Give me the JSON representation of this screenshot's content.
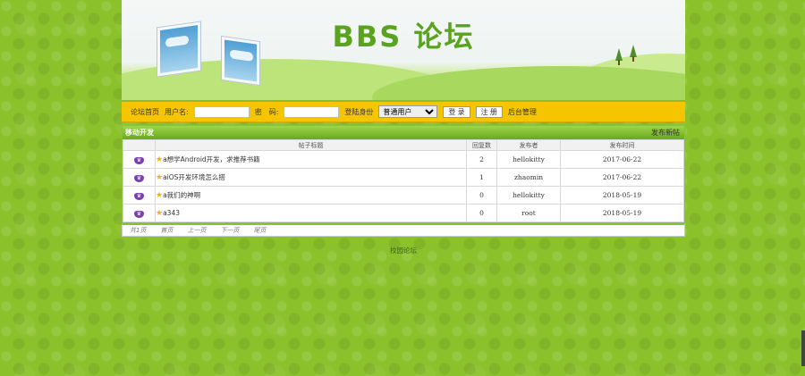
{
  "banner": {
    "title": "BBS 论坛"
  },
  "loginbar": {
    "home_link": "论坛首页",
    "username_label": "用户名:",
    "username_value": "",
    "password_label": "密　码:",
    "password_value": "",
    "role_label": "登陆身份",
    "role_selected": "普通用户",
    "login_button": "登 录",
    "register_button": "注 册",
    "admin_link": "后台管理"
  },
  "board": {
    "section_title": "移动开发",
    "new_post_link": "发布新帖",
    "columns": [
      "帖子标题",
      "回复数",
      "发布者",
      "发布时间"
    ],
    "rows": [
      {
        "title": "a想学Android开发，求推荐书籍",
        "replies": "2",
        "author": "hellokitty",
        "date": "2017-06-22"
      },
      {
        "title": "aiOS开发环境怎么搭",
        "replies": "1",
        "author": "zhaomin",
        "date": "2017-06-22"
      },
      {
        "title": "a我们的神啊",
        "replies": "0",
        "author": "hellokitty",
        "date": "2018-05-19"
      },
      {
        "title": "a343",
        "replies": "0",
        "author": "root",
        "date": "2018-05-19"
      }
    ]
  },
  "pager": {
    "total": "共1页",
    "first": "首页",
    "prev": "上一页",
    "next": "下一页",
    "last": "尾页"
  },
  "footer": {
    "text": "校园论坛"
  },
  "colors": {
    "page_bg": "#8bc22c",
    "login_bar": "#f5c500",
    "header_green": "#6aa81f",
    "title_green": "#5aa31f"
  },
  "icons": {
    "row_badge": "crown-badge-icon",
    "row_star": "star-icon"
  }
}
